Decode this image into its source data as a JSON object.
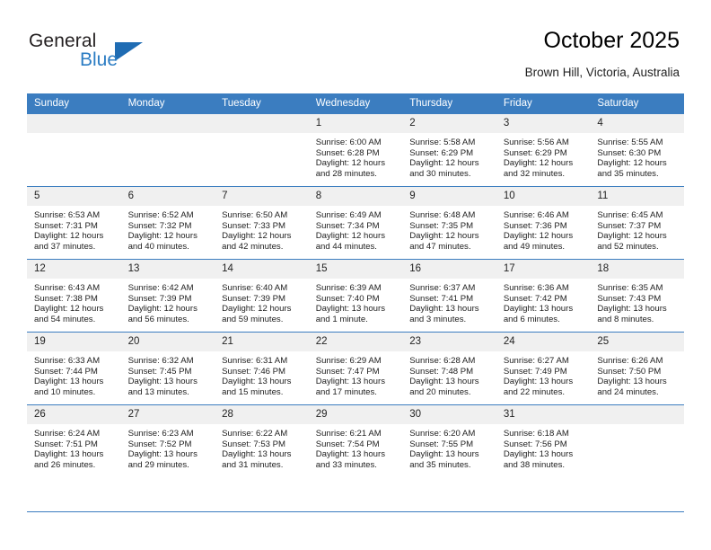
{
  "brand": {
    "line1": "General",
    "line2": "Blue",
    "triangle_color": "#1f6cb3",
    "blue_text_color": "#2b7cc3"
  },
  "header": {
    "title": "October 2025",
    "location": "Brown Hill, Victoria, Australia"
  },
  "theme": {
    "header_blue": "#3b7dc0",
    "daynum_band": "#f0f0f0",
    "text": "#222222"
  },
  "weekday_headers": [
    "Sunday",
    "Monday",
    "Tuesday",
    "Wednesday",
    "Thursday",
    "Friday",
    "Saturday"
  ],
  "labels": {
    "sunrise_prefix": "Sunrise:",
    "sunset_prefix": "Sunset:",
    "daylight_prefix": "Daylight:"
  },
  "weeks": [
    [
      {
        "day": "",
        "empty": true
      },
      {
        "day": "",
        "empty": true
      },
      {
        "day": "",
        "empty": true
      },
      {
        "day": "1",
        "sunrise": "Sunrise: 6:00 AM",
        "sunset": "Sunset: 6:28 PM",
        "daylight1": "Daylight: 12 hours",
        "daylight2": "and 28 minutes."
      },
      {
        "day": "2",
        "sunrise": "Sunrise: 5:58 AM",
        "sunset": "Sunset: 6:29 PM",
        "daylight1": "Daylight: 12 hours",
        "daylight2": "and 30 minutes."
      },
      {
        "day": "3",
        "sunrise": "Sunrise: 5:56 AM",
        "sunset": "Sunset: 6:29 PM",
        "daylight1": "Daylight: 12 hours",
        "daylight2": "and 32 minutes."
      },
      {
        "day": "4",
        "sunrise": "Sunrise: 5:55 AM",
        "sunset": "Sunset: 6:30 PM",
        "daylight1": "Daylight: 12 hours",
        "daylight2": "and 35 minutes."
      }
    ],
    [
      {
        "day": "5",
        "sunrise": "Sunrise: 6:53 AM",
        "sunset": "Sunset: 7:31 PM",
        "daylight1": "Daylight: 12 hours",
        "daylight2": "and 37 minutes."
      },
      {
        "day": "6",
        "sunrise": "Sunrise: 6:52 AM",
        "sunset": "Sunset: 7:32 PM",
        "daylight1": "Daylight: 12 hours",
        "daylight2": "and 40 minutes."
      },
      {
        "day": "7",
        "sunrise": "Sunrise: 6:50 AM",
        "sunset": "Sunset: 7:33 PM",
        "daylight1": "Daylight: 12 hours",
        "daylight2": "and 42 minutes."
      },
      {
        "day": "8",
        "sunrise": "Sunrise: 6:49 AM",
        "sunset": "Sunset: 7:34 PM",
        "daylight1": "Daylight: 12 hours",
        "daylight2": "and 44 minutes."
      },
      {
        "day": "9",
        "sunrise": "Sunrise: 6:48 AM",
        "sunset": "Sunset: 7:35 PM",
        "daylight1": "Daylight: 12 hours",
        "daylight2": "and 47 minutes."
      },
      {
        "day": "10",
        "sunrise": "Sunrise: 6:46 AM",
        "sunset": "Sunset: 7:36 PM",
        "daylight1": "Daylight: 12 hours",
        "daylight2": "and 49 minutes."
      },
      {
        "day": "11",
        "sunrise": "Sunrise: 6:45 AM",
        "sunset": "Sunset: 7:37 PM",
        "daylight1": "Daylight: 12 hours",
        "daylight2": "and 52 minutes."
      }
    ],
    [
      {
        "day": "12",
        "sunrise": "Sunrise: 6:43 AM",
        "sunset": "Sunset: 7:38 PM",
        "daylight1": "Daylight: 12 hours",
        "daylight2": "and 54 minutes."
      },
      {
        "day": "13",
        "sunrise": "Sunrise: 6:42 AM",
        "sunset": "Sunset: 7:39 PM",
        "daylight1": "Daylight: 12 hours",
        "daylight2": "and 56 minutes."
      },
      {
        "day": "14",
        "sunrise": "Sunrise: 6:40 AM",
        "sunset": "Sunset: 7:39 PM",
        "daylight1": "Daylight: 12 hours",
        "daylight2": "and 59 minutes."
      },
      {
        "day": "15",
        "sunrise": "Sunrise: 6:39 AM",
        "sunset": "Sunset: 7:40 PM",
        "daylight1": "Daylight: 13 hours",
        "daylight2": "and 1 minute."
      },
      {
        "day": "16",
        "sunrise": "Sunrise: 6:37 AM",
        "sunset": "Sunset: 7:41 PM",
        "daylight1": "Daylight: 13 hours",
        "daylight2": "and 3 minutes."
      },
      {
        "day": "17",
        "sunrise": "Sunrise: 6:36 AM",
        "sunset": "Sunset: 7:42 PM",
        "daylight1": "Daylight: 13 hours",
        "daylight2": "and 6 minutes."
      },
      {
        "day": "18",
        "sunrise": "Sunrise: 6:35 AM",
        "sunset": "Sunset: 7:43 PM",
        "daylight1": "Daylight: 13 hours",
        "daylight2": "and 8 minutes."
      }
    ],
    [
      {
        "day": "19",
        "sunrise": "Sunrise: 6:33 AM",
        "sunset": "Sunset: 7:44 PM",
        "daylight1": "Daylight: 13 hours",
        "daylight2": "and 10 minutes."
      },
      {
        "day": "20",
        "sunrise": "Sunrise: 6:32 AM",
        "sunset": "Sunset: 7:45 PM",
        "daylight1": "Daylight: 13 hours",
        "daylight2": "and 13 minutes."
      },
      {
        "day": "21",
        "sunrise": "Sunrise: 6:31 AM",
        "sunset": "Sunset: 7:46 PM",
        "daylight1": "Daylight: 13 hours",
        "daylight2": "and 15 minutes."
      },
      {
        "day": "22",
        "sunrise": "Sunrise: 6:29 AM",
        "sunset": "Sunset: 7:47 PM",
        "daylight1": "Daylight: 13 hours",
        "daylight2": "and 17 minutes."
      },
      {
        "day": "23",
        "sunrise": "Sunrise: 6:28 AM",
        "sunset": "Sunset: 7:48 PM",
        "daylight1": "Daylight: 13 hours",
        "daylight2": "and 20 minutes."
      },
      {
        "day": "24",
        "sunrise": "Sunrise: 6:27 AM",
        "sunset": "Sunset: 7:49 PM",
        "daylight1": "Daylight: 13 hours",
        "daylight2": "and 22 minutes."
      },
      {
        "day": "25",
        "sunrise": "Sunrise: 6:26 AM",
        "sunset": "Sunset: 7:50 PM",
        "daylight1": "Daylight: 13 hours",
        "daylight2": "and 24 minutes."
      }
    ],
    [
      {
        "day": "26",
        "sunrise": "Sunrise: 6:24 AM",
        "sunset": "Sunset: 7:51 PM",
        "daylight1": "Daylight: 13 hours",
        "daylight2": "and 26 minutes."
      },
      {
        "day": "27",
        "sunrise": "Sunrise: 6:23 AM",
        "sunset": "Sunset: 7:52 PM",
        "daylight1": "Daylight: 13 hours",
        "daylight2": "and 29 minutes."
      },
      {
        "day": "28",
        "sunrise": "Sunrise: 6:22 AM",
        "sunset": "Sunset: 7:53 PM",
        "daylight1": "Daylight: 13 hours",
        "daylight2": "and 31 minutes."
      },
      {
        "day": "29",
        "sunrise": "Sunrise: 6:21 AM",
        "sunset": "Sunset: 7:54 PM",
        "daylight1": "Daylight: 13 hours",
        "daylight2": "and 33 minutes."
      },
      {
        "day": "30",
        "sunrise": "Sunrise: 6:20 AM",
        "sunset": "Sunset: 7:55 PM",
        "daylight1": "Daylight: 13 hours",
        "daylight2": "and 35 minutes."
      },
      {
        "day": "31",
        "sunrise": "Sunrise: 6:18 AM",
        "sunset": "Sunset: 7:56 PM",
        "daylight1": "Daylight: 13 hours",
        "daylight2": "and 38 minutes."
      },
      {
        "day": "",
        "empty": true
      }
    ]
  ]
}
